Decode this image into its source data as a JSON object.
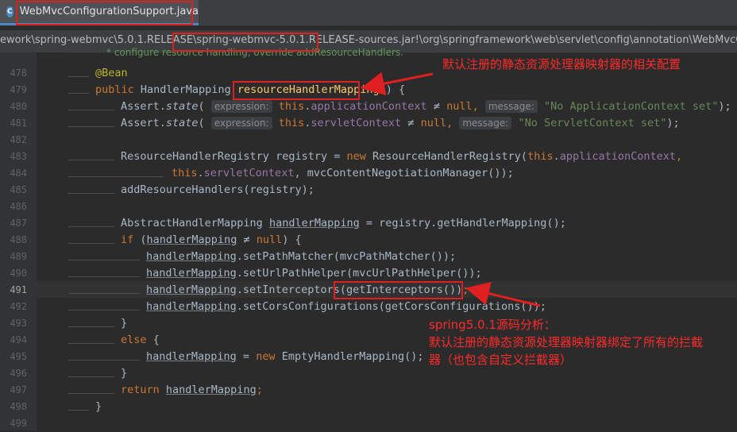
{
  "tab": {
    "icon": "java-class-icon",
    "icon_glyph": "C",
    "label": "WebMvcConfigurationSupport.java"
  },
  "breadcrumb": {
    "text": "ework\\spring-webmvc\\5.0.1.RELEASE\\spring-webmvc-5.0.1.RELEASE-sources.jar!\\org\\springframework\\web\\servlet\\config\\annotation\\WebMvcConfigurationSu"
  },
  "comment_fragment": "* configure resource handling, override addResourceHandlers.",
  "line_numbers": [
    "478",
    "479",
    "480",
    "481",
    "482",
    "483",
    "484",
    "485",
    "486",
    "487",
    "488",
    "489",
    "490",
    "491",
    "492",
    "493",
    "494",
    "495",
    "496",
    "497",
    "498",
    "499"
  ],
  "current_line": "491",
  "code": {
    "l478": "@Bean",
    "l479_kw": "public ",
    "l479_type": "HandlerMapping ",
    "l479_name": "resourceHandlerMapping",
    "l479_end": "() {",
    "l480_a": "Assert.",
    "l480_b": "state",
    "l480_c": "( ",
    "l480_hint": "expression:",
    "l480_this": " this",
    "l480_dot": ".",
    "l480_fld": "applicationContext",
    "l480_ne": " ≠ ",
    "l480_null": "null",
    "l480_comma": ", ",
    "l480_hint2": "message:",
    "l480_str": " \"No ApplicationContext set\"",
    "l480_end": ");",
    "l481_a": "Assert.",
    "l481_b": "state",
    "l481_c": "( ",
    "l481_hint": "expression:",
    "l481_this": " this",
    "l481_dot": ".",
    "l481_fld": "servletContext",
    "l481_ne": " ≠ ",
    "l481_null": "null",
    "l481_comma": ", ",
    "l481_hint2": "message:",
    "l481_str": " \"No ServletContext set\"",
    "l481_end": ");",
    "l483_a": "ResourceHandlerRegistry registry = ",
    "l483_new": "new ",
    "l483_b": "ResourceHandlerRegistry(",
    "l483_this": "this",
    "l483_dot": ".",
    "l483_fld": "applicationContext",
    "l483_end": ",",
    "l484_this": "this",
    "l484_dot": ".",
    "l484_fld": "servletContext",
    "l484_end": ", mvcContentNegotiationManager());",
    "l485": "addResourceHandlers(registry);",
    "l487_a": "AbstractHandlerMapping ",
    "l487_var": "handlerMapping",
    "l487_b": " = registry.getHandlerMapping();",
    "l488_if": "if ",
    "l488_a": "(",
    "l488_var": "handlerMapping",
    "l488_ne": " ≠ ",
    "l488_null": "null",
    "l488_end": ") {",
    "l489_var": "handlerMapping",
    "l489_b": ".setPathMatcher(mvcPathMatcher());",
    "l490_var": "handlerMapping",
    "l490_b": ".setUrlPathHelper(mvcUrlPathHelper());",
    "l491_var": "handlerMapping",
    "l491_b": ".setInterceptors",
    "l491_c": "(getInterceptors())",
    "l491_end": ";",
    "l492_var": "handlerMapping",
    "l492_b": ".setCorsConfigurations(getCorsConfigurations());",
    "l493": "}",
    "l494_kw": "else ",
    "l494_end": "{",
    "l495_var": "handlerMapping",
    "l495_b": " = ",
    "l495_new": "new ",
    "l495_c": "EmptyHandlerMapping();",
    "l496": "}",
    "l497_kw": "return ",
    "l497_var": "handlerMapping",
    "l497_end": ";",
    "l498": "}"
  },
  "annotations": {
    "note1": "默认注册的静态资源处理器映射器的相关配置",
    "note2_line1": "spring5.0.1源码分析：",
    "note2_line2": "默认注册的静态资源处理器映射器绑定了所有的拦截",
    "note2_line3": "器（也包含自定义拦截器）"
  },
  "colors": {
    "background": "#2b2b2b",
    "keyword": "#cc7832",
    "annotation": "#bbb529",
    "field": "#9876aa",
    "string": "#6a8759",
    "markup_red": "#e02020"
  }
}
